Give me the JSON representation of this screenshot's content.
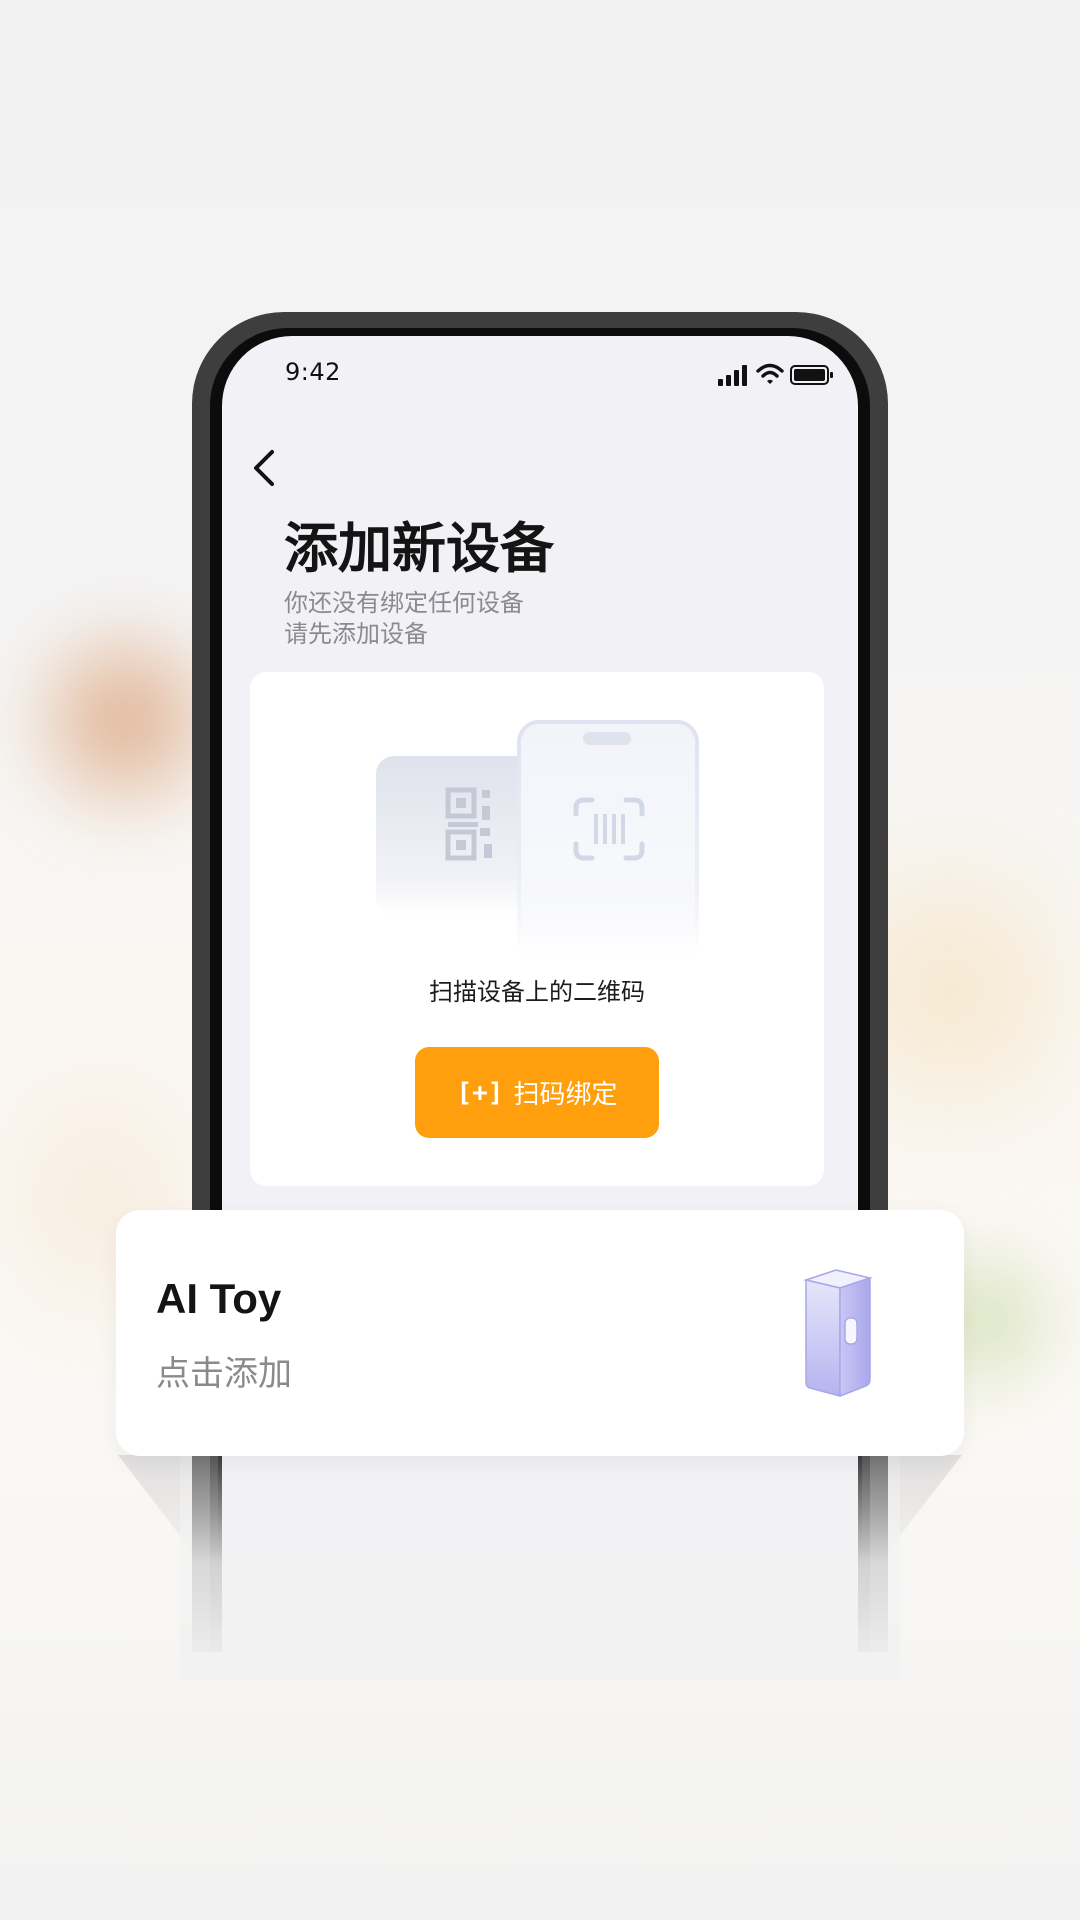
{
  "status_bar": {
    "time": "9:42",
    "icons": [
      "signal-icon",
      "wifi-icon",
      "battery-icon"
    ]
  },
  "header": {
    "back_icon": "chevron-left-icon",
    "title": "添加新设备",
    "subtitle_line1": "你还没有绑定任何设备",
    "subtitle_line2": "请先添加设备"
  },
  "scan_card": {
    "illustration": "qr-code-phone-scan-illustration",
    "label": "扫描设备上的二维码",
    "button_icon": "[+]",
    "button_label": "扫码绑定",
    "button_color": "#FF9F0E"
  },
  "device_card": {
    "title": "AI Toy",
    "subtitle": "点击添加",
    "icon": "device-box-icon",
    "icon_color": "#B8B6F2"
  }
}
